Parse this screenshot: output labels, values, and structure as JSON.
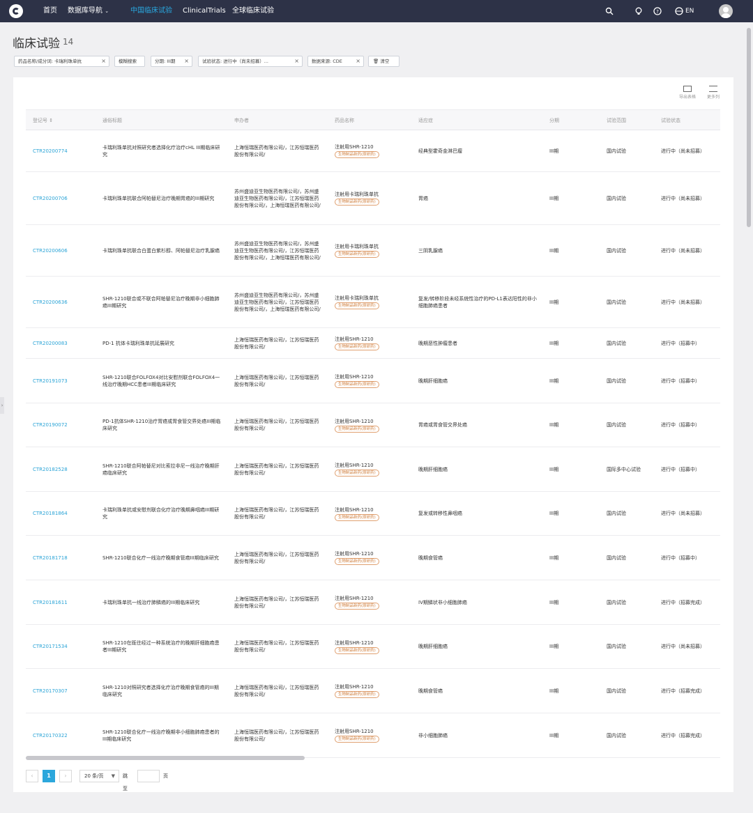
{
  "nav": {
    "items": [
      "首页",
      "数据库导航",
      "中国临床试验",
      "ClinicalTrials",
      "全球临床试验"
    ],
    "active_index": 2,
    "lang": "EN"
  },
  "page": {
    "title": "临床试验",
    "count": "14"
  },
  "filters": [
    "药品名称/成分词: 卡瑞利珠单抗",
    "模糊搜索",
    "分期: III期",
    "试验状态: 进行中（尚未招募）...",
    "数据来源: CDE",
    "清空"
  ],
  "toolbar": {
    "export_label": "导出表格",
    "more_label": "更多列"
  },
  "table": {
    "headers": [
      "登记号",
      "通俗标题",
      "申办者",
      "药品名称",
      "适应症",
      "分期",
      "试验范围",
      "试验状态"
    ],
    "rows": [
      {
        "id": "CTR20200774",
        "title": "卡瑞利珠单抗对照研究者选择化疗治疗cHL III期临床研究",
        "sponsor": "上海恒瑞医药有限公司/，江苏恒瑞医药股份有限公司/",
        "drug": "注射用SHR-1210",
        "tag": "生物制品新药(原研药)",
        "indication": "经典型霍奇金淋巴瘤",
        "phase": "III期",
        "scope": "国内试验",
        "status": "进行中（尚未招募）"
      },
      {
        "id": "CTR20200706",
        "title": "卡瑞利珠单抗联合阿帕替尼治疗晚期胃癌的III期研究",
        "sponsor": "苏州盛迪亚生物医药有限公司/，苏州盛迪亚生物医药有限公司/，江苏恒瑞医药股份有限公司/，上海恒瑞医药有限公司/",
        "drug": "注射用卡瑞利珠单抗",
        "tag": "生物制品新药(原研药)",
        "indication": "胃癌",
        "phase": "III期",
        "scope": "国内试验",
        "status": "进行中（尚未招募）"
      },
      {
        "id": "CTR20200606",
        "title": "卡瑞利珠单抗联合白蛋白紫杉醇、阿帕替尼治疗乳腺癌",
        "sponsor": "苏州盛迪亚生物医药有限公司/，苏州盛迪亚生物医药有限公司/，江苏恒瑞医药股份有限公司/，上海恒瑞医药有限公司/",
        "drug": "注射用卡瑞利珠单抗",
        "tag": "生物制品新药(原研药)",
        "indication": "三阴乳腺癌",
        "phase": "III期",
        "scope": "国内试验",
        "status": "进行中（尚未招募）"
      },
      {
        "id": "CTR20200636",
        "title": "SHR-1210联合或不联合阿帕替尼治疗晚期非小细胞肺癌III期研究",
        "sponsor": "苏州盛迪亚生物医药有限公司/，苏州盛迪亚生物医药有限公司/，江苏恒瑞医药股份有限公司/，上海恒瑞医药有限公司/",
        "drug": "注射用卡瑞利珠单抗",
        "tag": "生物制品新药(原研药)",
        "indication": "复发/转移阶段未经系统性治疗的PD-L1表达阳性的非小细胞肺癌患者",
        "phase": "III期",
        "scope": "国内试验",
        "status": "进行中（尚未招募）"
      },
      {
        "id": "CTR20200083",
        "title": "PD-1 抗体卡瑞利珠单抗延展研究",
        "sponsor": "上海恒瑞医药有限公司/，江苏恒瑞医药股份有限公司/",
        "drug": "注射用SHR-1210",
        "tag": "生物制品新药(原研药)",
        "indication": "晚期恶性肿瘤患者",
        "phase": "III期",
        "scope": "国内试验",
        "status": "进行中（招募中）"
      },
      {
        "id": "CTR20191073",
        "title": "SHR-1210联合FOLFOX4对比安慰剂联合FOLFOX4一线治疗晚期HCC患者III期临床研究",
        "sponsor": "上海恒瑞医药有限公司/，江苏恒瑞医药股份有限公司/",
        "drug": "注射用SHR-1210",
        "tag": "生物制品新药(原研药)",
        "indication": "晚期肝细胞癌",
        "phase": "III期",
        "scope": "国内试验",
        "status": "进行中（招募中）"
      },
      {
        "id": "CTR20190072",
        "title": "PD-1抗体SHR-1210治疗胃癌或胃食管交界处癌III期临床研究",
        "sponsor": "上海恒瑞医药有限公司/，江苏恒瑞医药股份有限公司/",
        "drug": "注射用SHR-1210",
        "tag": "生物制品新药(原研药)",
        "indication": "胃癌或胃食管交界处癌",
        "phase": "III期",
        "scope": "国内试验",
        "status": "进行中（招募中）"
      },
      {
        "id": "CTR20182528",
        "title": "SHR-1210联合阿帕替尼对比索拉非尼一线治疗晚期肝癌临床研究",
        "sponsor": "上海恒瑞医药有限公司/，江苏恒瑞医药股份有限公司/",
        "drug": "注射用SHR-1210",
        "tag": "生物制品新药(原研药)",
        "indication": "晚期肝细胞癌",
        "phase": "III期",
        "scope": "国际多中心试验",
        "status": "进行中（招募中）"
      },
      {
        "id": "CTR20181864",
        "title": "卡瑞利珠单抗或安慰剂联合化疗治疗晚期鼻咽癌III期研究",
        "sponsor": "上海恒瑞医药有限公司/，江苏恒瑞医药股份有限公司/",
        "drug": "注射用SHR-1210",
        "tag": "生物制品新药(原研药)",
        "indication": "复发或转移性鼻咽癌",
        "phase": "III期",
        "scope": "国内试验",
        "status": "进行中（尚未招募）"
      },
      {
        "id": "CTR20181718",
        "title": "SHR-1210联合化疗一线治疗晚期食管癌III期临床研究",
        "sponsor": "上海恒瑞医药有限公司/，江苏恒瑞医药股份有限公司/",
        "drug": "注射用SHR-1210",
        "tag": "生物制品新药(原研药)",
        "indication": "晚期食管癌",
        "phase": "III期",
        "scope": "国内试验",
        "status": "进行中（招募中）"
      },
      {
        "id": "CTR20181611",
        "title": "卡瑞利珠单抗一线治疗肺鳞癌的III期临床研究",
        "sponsor": "上海恒瑞医药有限公司/，江苏恒瑞医药股份有限公司/",
        "drug": "注射用SHR-1210",
        "tag": "生物制品新药(原研药)",
        "indication": "IV期鳞状非小细胞肺癌",
        "phase": "III期",
        "scope": "国内试验",
        "status": "进行中（招募完成）"
      },
      {
        "id": "CTR20171534",
        "title": "SHR-1210在既往经过一种系统治疗的晚期肝细胞癌患者III期研究",
        "sponsor": "上海恒瑞医药有限公司/，江苏恒瑞医药股份有限公司/",
        "drug": "注射用SHR-1210",
        "tag": "生物制品新药(原研药)",
        "indication": "晚期肝细胞癌",
        "phase": "III期",
        "scope": "国内试验",
        "status": "进行中（尚未招募）"
      },
      {
        "id": "CTR20170307",
        "title": "SHR-1210对照研究者选择化疗治疗晚期食管癌的III期临床研究",
        "sponsor": "上海恒瑞医药有限公司/，江苏恒瑞医药股份有限公司/",
        "drug": "注射用SHR-1210",
        "tag": "生物制品新药(原研药)",
        "indication": "晚期食管癌",
        "phase": "III期",
        "scope": "国内试验",
        "status": "进行中（招募完成）"
      },
      {
        "id": "CTR20170322",
        "title": "SHR-1210联合化疗一线治疗晚期非小细胞肺癌患者的III期临床研究",
        "sponsor": "上海恒瑞医药有限公司/，江苏恒瑞医药股份有限公司/",
        "drug": "注射用SHR-1210",
        "tag": "生物制品新药(原研药)",
        "indication": "非小细胞肺癌",
        "phase": "III期",
        "scope": "国内试验",
        "status": "进行中（招募完成）"
      }
    ]
  },
  "pagination": {
    "prev": "‹",
    "current": "1",
    "next": "›",
    "page_size": "20 条/页",
    "goto_label": "跳至",
    "page_suffix": "页"
  },
  "colors": {
    "nav_bg": "#2d3247",
    "accent": "#29a9e1",
    "tag_border": "#e0a070"
  }
}
